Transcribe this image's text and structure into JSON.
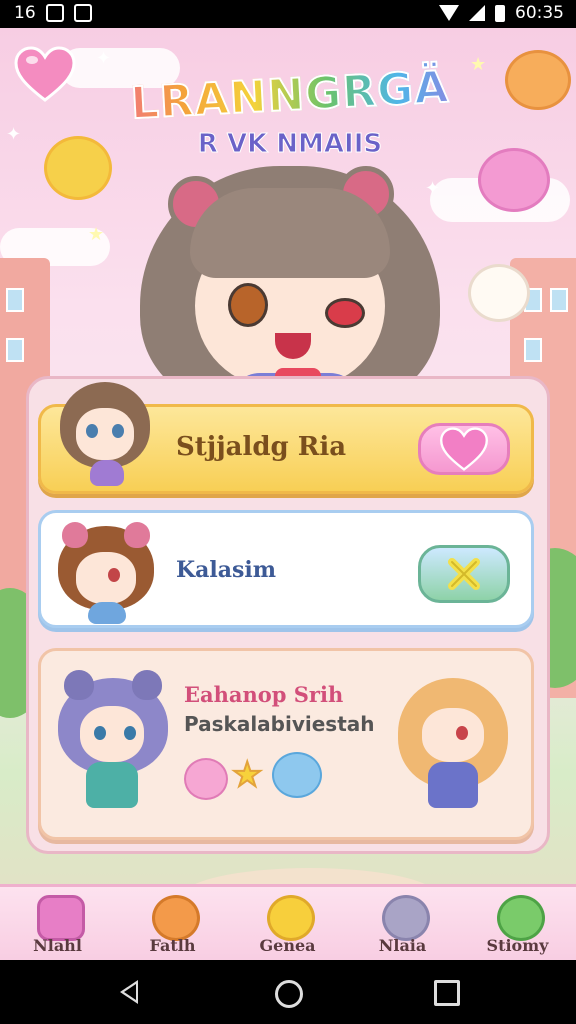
{
  "status_bar": {
    "left_text": "16",
    "time": "60:35"
  },
  "logo": {
    "line1": "LRANNGRGÄ",
    "line2": "R VK NMAIIS"
  },
  "cards": [
    {
      "label": "Stjjaldg Ria",
      "button": "heart"
    },
    {
      "label": "Kalasim",
      "button": "close"
    },
    {
      "title": "Eahanop Srih",
      "subtitle": "Paskalabiviestah"
    }
  ],
  "nav": [
    {
      "label": "Nlahl"
    },
    {
      "label": "Fatlh"
    },
    {
      "label": "Genea"
    },
    {
      "label": "Nlaia"
    },
    {
      "label": "Stiomy"
    }
  ],
  "icons": {
    "heart": "heart-icon",
    "close": "close-x-icon",
    "star": "star-icon"
  },
  "colors": {
    "card1": "#f8cf55",
    "card2": "#ffffff",
    "card3": "#fbeae0",
    "accent_pink": "#f598d0",
    "accent_green": "#8ed2a8"
  }
}
